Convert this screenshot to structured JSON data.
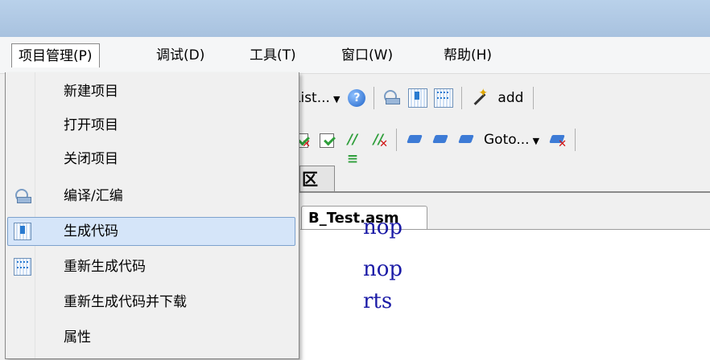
{
  "menubar": {
    "items": [
      {
        "label": "项目管理(P)"
      },
      {
        "label": "调试(D)"
      },
      {
        "label": "工具(T)"
      },
      {
        "label": "窗口(W)"
      },
      {
        "label": "帮助(H)"
      }
    ]
  },
  "dropdown": {
    "items": [
      {
        "label": "新建项目",
        "icon": ""
      },
      {
        "label": "打开项目",
        "icon": ""
      },
      {
        "label": "关闭项目",
        "icon": ""
      },
      {
        "label": "编译/汇编",
        "icon": "compile-icon"
      },
      {
        "label": "生成代码",
        "icon": "build-icon",
        "highlighted": true
      },
      {
        "label": "重新生成代码",
        "icon": "rebuild-icon"
      },
      {
        "label": "重新生成代码并下载",
        "icon": ""
      },
      {
        "label": "属性",
        "icon": ""
      }
    ]
  },
  "toolbar1": {
    "list_combo": "List...",
    "add_label": "add"
  },
  "toolbar2": {
    "goto_combo": "Goto..."
  },
  "pane_tab": "区",
  "file_tab": "B_Test.asm",
  "code_lines": [
    "nop",
    "nop",
    "rts"
  ],
  "colors": {
    "titlebar": "#b9d1ea",
    "highlight": "#d5e5f9",
    "code": "#1a1aa6"
  }
}
